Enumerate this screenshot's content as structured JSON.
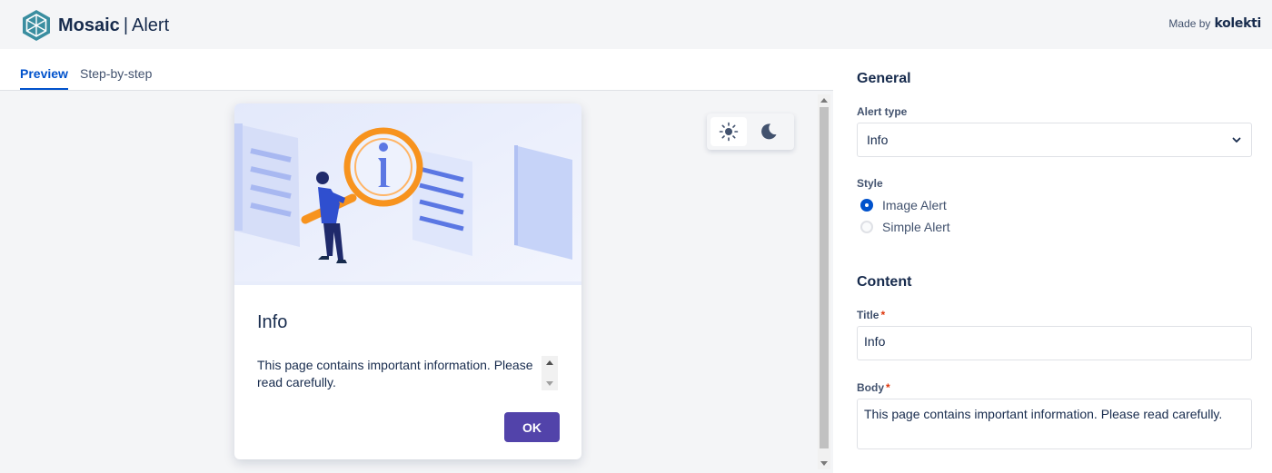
{
  "app": {
    "brand": "Mosaic",
    "separator": "|",
    "component": "Alert",
    "made_by_label": "Made by",
    "made_by_brand": "kolekti"
  },
  "tabs": [
    {
      "label": "Preview",
      "active": true
    },
    {
      "label": "Step-by-step",
      "active": false
    }
  ],
  "preview": {
    "theme": {
      "light_icon": "sun-icon",
      "dark_icon": "moon-icon",
      "selected": "light"
    },
    "alert": {
      "title": "Info",
      "body": "This page contains important information. Please read carefully.",
      "ok_label": "OK",
      "image_icon": "magnifying-glass-info-illustration"
    }
  },
  "settings": {
    "general": {
      "heading": "General",
      "alert_type_label": "Alert type",
      "alert_type_value": "Info",
      "style_label": "Style",
      "style_options": [
        {
          "label": "Image Alert",
          "selected": true
        },
        {
          "label": "Simple Alert",
          "selected": false
        }
      ]
    },
    "content": {
      "heading": "Content",
      "title_label": "Title",
      "title_value": "Info",
      "body_label": "Body",
      "body_value": "This page contains important information. Please read carefully.",
      "required_marker": "*"
    }
  },
  "colors": {
    "accent": "#0052cc",
    "button": "#5243aa",
    "illustration_orange": "#f7931e",
    "illustration_blue": "#2f4fcf"
  }
}
